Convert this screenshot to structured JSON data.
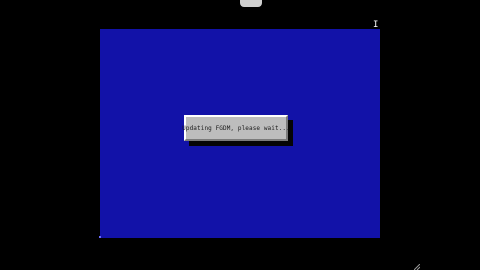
{
  "dialog": {
    "message": "Updating FGDM, please wait..."
  },
  "cursor": {
    "icon": "text-cursor-icon",
    "glyph": "I"
  },
  "colors": {
    "desktop": "#000000",
    "screen": "#1212a8",
    "dialog": "#bdbdbd",
    "dialog_text": "#1a1a1a"
  }
}
